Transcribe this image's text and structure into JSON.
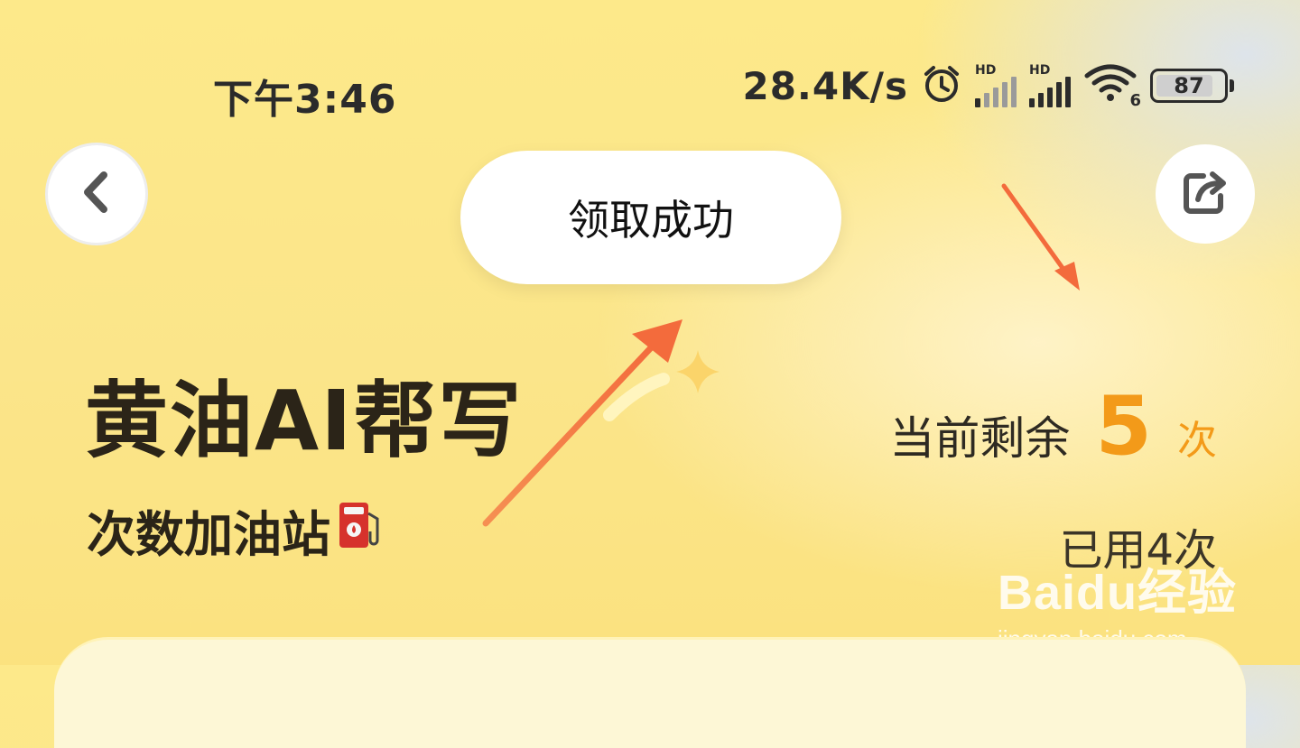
{
  "status_bar": {
    "time": "下午3:46",
    "net_speed": "28.4K/s",
    "sig1_label": "HD",
    "sig2_label": "HD",
    "wifi_label": "6",
    "battery": "87",
    "icons": [
      "alarm-icon",
      "signal-icon",
      "signal-icon",
      "wifi-icon",
      "battery-icon"
    ]
  },
  "toast": {
    "text": "领取成功"
  },
  "header": {
    "back_icon": "chevron-left-icon",
    "share_icon": "share-icon"
  },
  "title": {
    "main": "黄油AI帮写",
    "subtitle": "次数加油站"
  },
  "counts": {
    "remain_label": "当前剩余",
    "remain_value": "5",
    "remain_unit": "次",
    "used_text": "已用4次"
  },
  "watermark": {
    "logo": "Baidu经验",
    "url": "jingyan.baidu.com"
  },
  "colors": {
    "accent": "#f39a19",
    "background": "#fbe58a",
    "arrow": "#f36b3c"
  }
}
